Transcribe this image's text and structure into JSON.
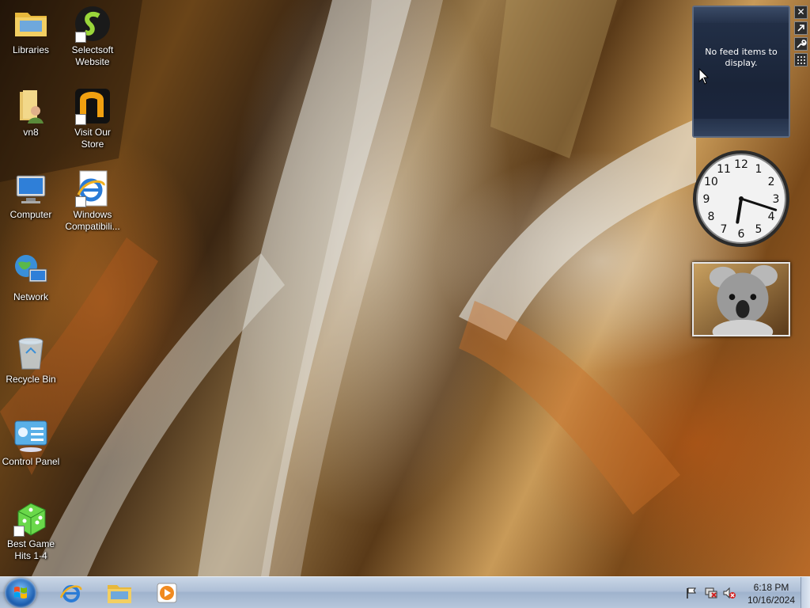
{
  "desktop": {
    "icons": [
      {
        "label": "Libraries",
        "icon": "libraries-folder-icon"
      },
      {
        "label": "Selectsoft\nWebsite",
        "icon": "selectsoft-logo-icon"
      },
      {
        "label": "vn8",
        "icon": "user-folder-icon"
      },
      {
        "label": "Visit Our\nStore",
        "icon": "store-logo-icon"
      },
      {
        "label": "Computer",
        "icon": "computer-icon"
      },
      {
        "label": "Windows\nCompatibili...",
        "icon": "internet-explorer-icon"
      },
      {
        "label": "Network",
        "icon": "network-globe-icon"
      },
      {
        "label": "Recycle Bin",
        "icon": "recycle-bin-icon"
      },
      {
        "label": "Control Panel",
        "icon": "control-panel-icon"
      },
      {
        "label": "Best Game\nHits 1-4",
        "icon": "dice-game-icon"
      }
    ]
  },
  "gadgets": {
    "feed": {
      "message": "No feed items to display."
    },
    "tools": {
      "close": "✕",
      "options": "wrench-icon"
    },
    "clock": {
      "hour": 6,
      "minute": 18
    },
    "photo": {
      "subject": "koala-photo"
    }
  },
  "taskbar": {
    "pinned": [
      "internet-explorer-icon",
      "windows-explorer-icon",
      "media-player-icon"
    ],
    "tray": [
      "action-center-flag-icon",
      "network-icon",
      "volume-muted-icon"
    ],
    "time": "6:18 PM",
    "date": "10/16/2024"
  },
  "colors": {
    "taskbar": "#aebfd6",
    "gadget_bg": "#1a2438",
    "accent": "#1e5fb0"
  }
}
